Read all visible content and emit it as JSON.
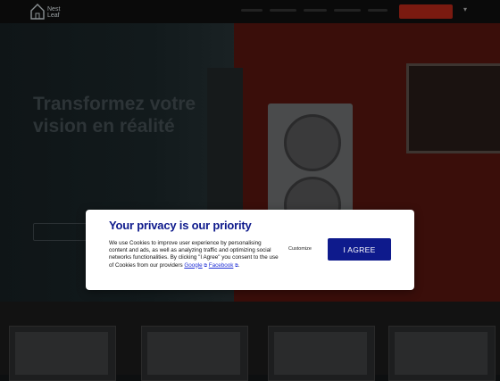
{
  "brand": {
    "name_line1": "Nest",
    "name_line2": "Leaf"
  },
  "hero": {
    "title": "Transformez votre vision en réalité"
  },
  "consent": {
    "title": "Your privacy is our priority",
    "body_before": "We use Cookies to improve user experience by personalising content and ads, as well as analyzing traffic and optimizing social networks functionalities. By clicking \"I Agree\" you consent to the use of Cookies from our providers ",
    "link_google": "Google",
    "link_facebook": "Facebook",
    "body_after": ".",
    "customize_label": "Customize",
    "agree_label": "I AGREE",
    "colors": {
      "title": "#0e1a8c",
      "agree_bg": "#0e1a8c",
      "link": "#1f2fd6"
    }
  },
  "icons": {
    "external_link": "external-link-icon",
    "logo": "house-logo-icon"
  }
}
